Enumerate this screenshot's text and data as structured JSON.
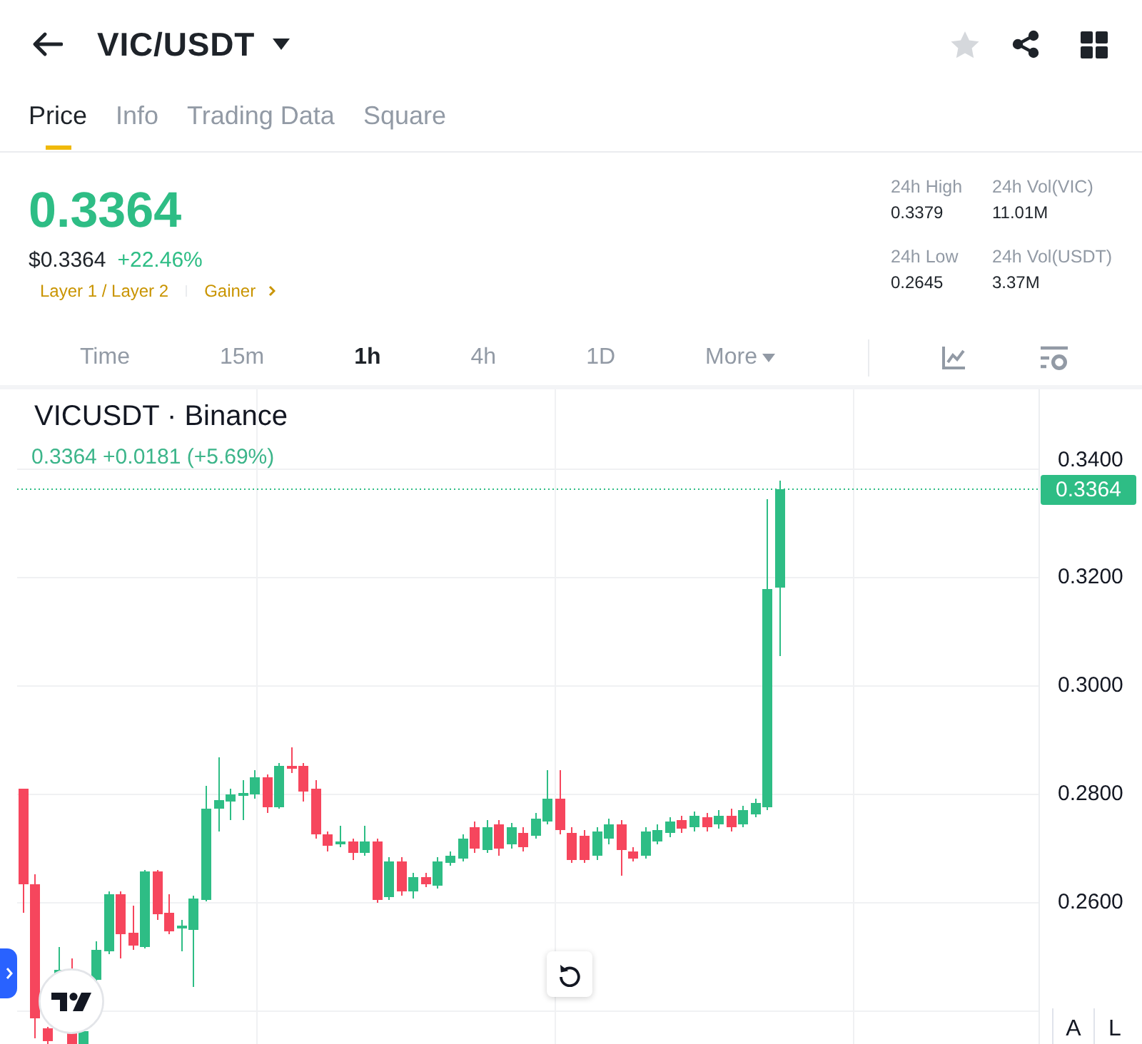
{
  "header": {
    "title": "VIC/USDT",
    "favorite": false
  },
  "tabs": [
    {
      "label": "Price",
      "selected": true
    },
    {
      "label": "Info",
      "selected": false
    },
    {
      "label": "Trading Data",
      "selected": false
    },
    {
      "label": "Square",
      "selected": false
    }
  ],
  "ticker": {
    "price": "0.3364",
    "fiat_price": "$0.3364",
    "change": "+22.46%",
    "tags": [
      {
        "label": "Layer 1 / Layer 2",
        "kind": "plain"
      },
      {
        "label": "Gainer",
        "kind": "link"
      }
    ]
  },
  "stats": [
    {
      "label": "24h High",
      "value": "0.3379"
    },
    {
      "label": "24h Vol(VIC)",
      "value": "11.01M"
    },
    {
      "label": "24h Low",
      "value": "0.2645"
    },
    {
      "label": "24h Vol(USDT)",
      "value": "3.37M"
    }
  ],
  "intervals": [
    {
      "label": "Time",
      "kind": "option",
      "selected": false
    },
    {
      "label": "15m",
      "kind": "option",
      "selected": false
    },
    {
      "label": "1h",
      "kind": "option",
      "selected": true
    },
    {
      "label": "4h",
      "kind": "option",
      "selected": false
    },
    {
      "label": "1D",
      "kind": "option",
      "selected": false
    },
    {
      "label": "More",
      "kind": "menu",
      "selected": false
    }
  ],
  "chart": {
    "title": "VICUSDT · Binance",
    "quote": "0.3364 +0.0181 (+5.69%)",
    "price_labels": [
      "0.3400",
      "0.3200",
      "0.3000",
      "0.2800",
      "0.2600"
    ],
    "last_price": "0.3364",
    "scale_buttons": [
      "A",
      "L"
    ]
  }
}
